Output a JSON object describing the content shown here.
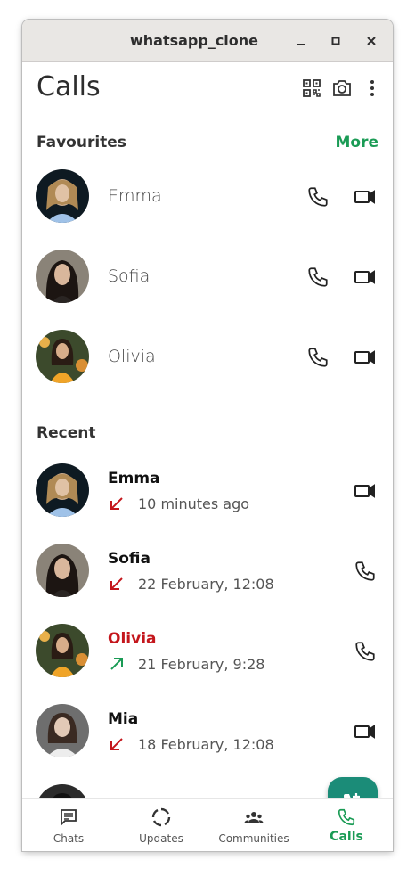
{
  "window": {
    "title": "whatsapp_clone"
  },
  "header": {
    "title": "Calls"
  },
  "favourites": {
    "title": "Favourites",
    "more_label": "More",
    "items": [
      {
        "name": "Emma"
      },
      {
        "name": "Sofia"
      },
      {
        "name": "Olivia"
      }
    ]
  },
  "recent": {
    "title": "Recent",
    "items": [
      {
        "name": "Emma",
        "time": "10 minutes ago",
        "direction": "incoming-missed",
        "call_type": "video"
      },
      {
        "name": "Sofia",
        "time": "22 February, 12:08",
        "direction": "incoming-missed",
        "call_type": "voice"
      },
      {
        "name": "Olivia",
        "time": "21 February, 9:28",
        "direction": "outgoing",
        "call_type": "voice",
        "missed": true
      },
      {
        "name": "Mia",
        "time": "18 February, 12:08",
        "direction": "incoming-missed",
        "call_type": "video"
      }
    ]
  },
  "nav": {
    "items": [
      {
        "label": "Chats",
        "icon": "chat-icon"
      },
      {
        "label": "Updates",
        "icon": "updates-icon"
      },
      {
        "label": "Communities",
        "icon": "communities-icon"
      },
      {
        "label": "Calls",
        "icon": "phone-icon",
        "active": true
      }
    ]
  },
  "colors": {
    "accent": "#1a9b55",
    "fab": "#1b8c78",
    "missed": "#c4161c"
  }
}
